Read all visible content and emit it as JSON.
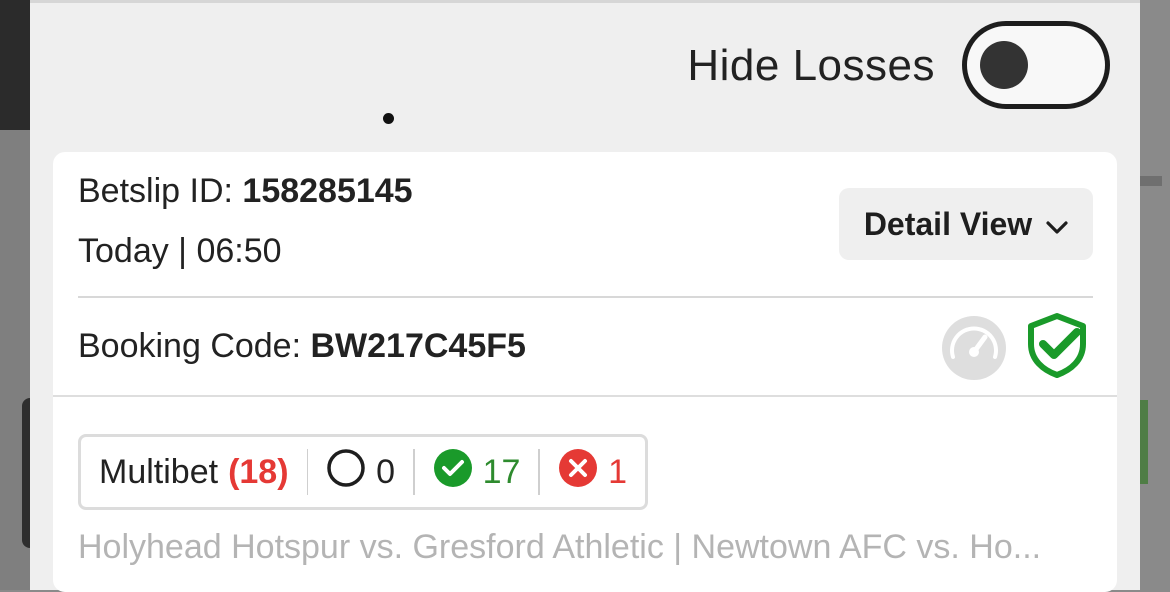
{
  "hide_losses": {
    "label": "Hide Losses",
    "enabled": false
  },
  "betslip": {
    "id_label": "Betslip ID:",
    "id_value": "158285145",
    "datetime": "Today | 06:50",
    "detail_view_label": "Detail View",
    "booking_label": "Booking Code:",
    "booking_value": "BW217C45F5"
  },
  "summary": {
    "type_label": "Multibet",
    "total": "(18)",
    "pending_count": "0",
    "won_count": "17",
    "lost_count": "1"
  },
  "matches_text": "Holyhead Hotspur vs. Gresford Athletic | Newtown AFC vs. Ho...",
  "icons": {
    "toggle": "toggle-switch",
    "detail_chevron": "chevron-down-icon",
    "gauge": "gauge-icon",
    "shield": "shield-check-icon",
    "pending": "circle-outline-icon",
    "won": "check-circle-icon",
    "lost": "x-circle-icon"
  },
  "colors": {
    "won": "#1a9a2a",
    "lost": "#e53935",
    "accent_shield": "#1a9a2a"
  }
}
